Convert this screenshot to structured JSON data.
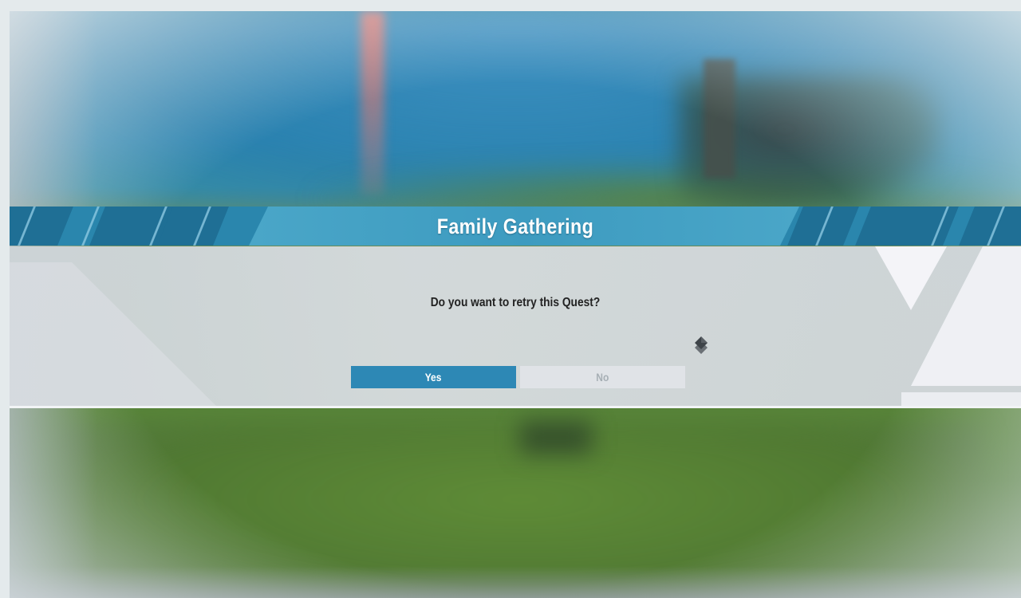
{
  "dialog": {
    "title": "Family Gathering",
    "question": "Do you want to retry this Quest?",
    "selected_option": "Yes",
    "buttons": {
      "yes_label": "Yes",
      "no_label": "No"
    }
  },
  "icons": {
    "selection_cursor": "diamond-cursor-icon"
  },
  "colors": {
    "banner": "#2a86ad",
    "selected_button": "#2d88b5",
    "unselected_button_text": "#a7afb5"
  }
}
